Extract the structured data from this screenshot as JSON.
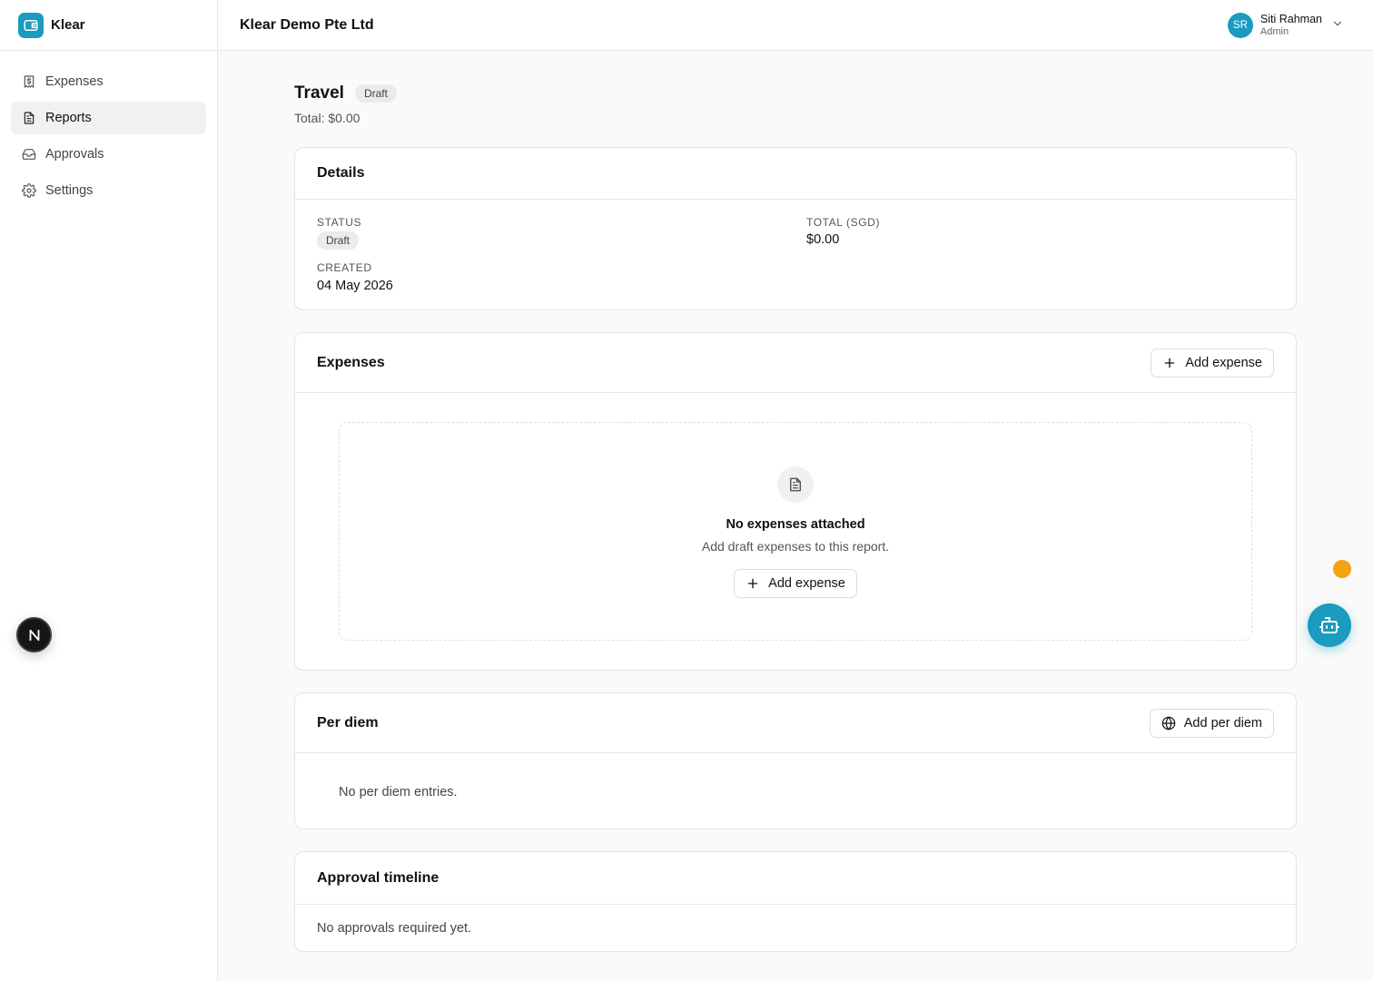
{
  "brand": {
    "name": "Klear",
    "icon": "wallet-icon"
  },
  "sidebar": {
    "items": [
      {
        "label": "Expenses",
        "icon": "receipt-icon",
        "active": false
      },
      {
        "label": "Reports",
        "icon": "file-text-icon",
        "active": true
      },
      {
        "label": "Approvals",
        "icon": "inbox-icon",
        "active": false
      },
      {
        "label": "Settings",
        "icon": "gear-icon",
        "active": false
      }
    ]
  },
  "header": {
    "org_name": "Klear Demo Pte Ltd",
    "user": {
      "initials": "SR",
      "name": "Siti Rahman",
      "role": "Admin"
    }
  },
  "report": {
    "title": "Travel",
    "status_badge": "Draft",
    "total_line": "Total: $0.00"
  },
  "details": {
    "title": "Details",
    "status_label": "STATUS",
    "status_value": "Draft",
    "total_label": "TOTAL (SGD)",
    "total_value": "$0.00",
    "created_label": "CREATED",
    "created_value": "04 May 2026"
  },
  "expenses": {
    "title": "Expenses",
    "add_label": "Add expense",
    "empty_title": "No expenses attached",
    "empty_subtitle": "Add draft expenses to this report.",
    "empty_add_label": "Add expense"
  },
  "per_diem": {
    "title": "Per diem",
    "add_label": "Add per diem",
    "empty_text": "No per diem entries."
  },
  "approval_timeline": {
    "title": "Approval timeline",
    "empty_text": "No approvals required yet."
  },
  "dev_badge": {
    "label": "N"
  },
  "colors": {
    "accent": "#1a9bbf",
    "notify": "#f5a30f"
  }
}
